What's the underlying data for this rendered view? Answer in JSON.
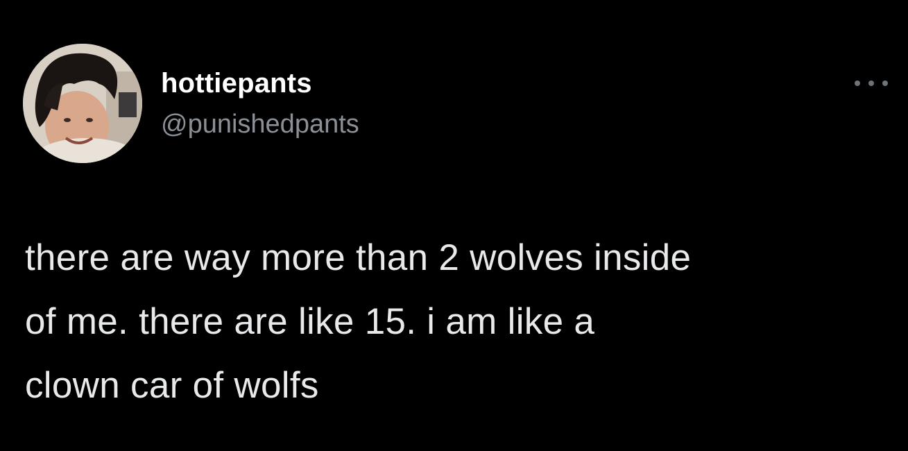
{
  "tweet": {
    "author": {
      "display_name": "hottiepants",
      "handle": "@punishedpants",
      "avatar_icon": "profile-photo"
    },
    "more_icon": "more-horizontal-icon",
    "text_lines": [
      "there are way more than 2 wolves inside",
      "of me. there are like 15. i am like a",
      "clown car of wolfs"
    ]
  },
  "colors": {
    "background": "#000000",
    "name": "#ffffff",
    "handle": "#8b9096",
    "body_text": "#e7e9ea",
    "more_dots": "#6e7378"
  }
}
